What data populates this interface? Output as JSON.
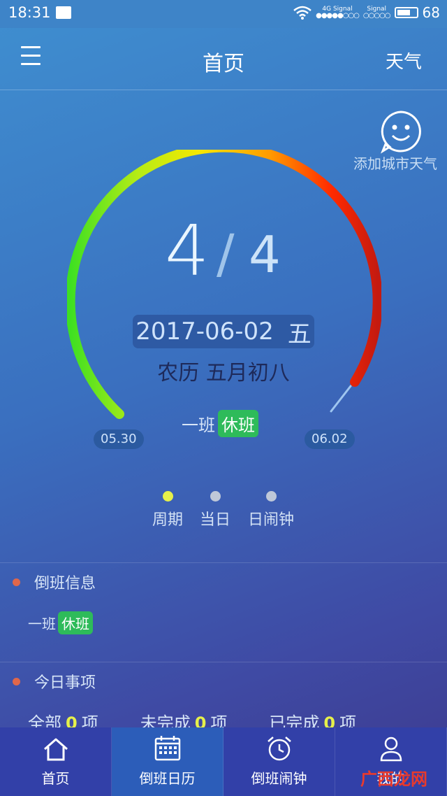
{
  "status_bar": {
    "time": "18:31",
    "network": "4G",
    "signal1": "Signal",
    "signal2": "Signal",
    "battery": "68"
  },
  "header": {
    "title": "首页",
    "weather": "天气"
  },
  "weather_widget": {
    "add_city": "添加城市天气"
  },
  "cycle": {
    "current": "4",
    "slash": "/",
    "total": "4",
    "date": "2017-06-02",
    "weekday": "五",
    "lunar": "农历 五月初八",
    "start_date": "05.30",
    "end_date": "06.02",
    "shift_name": "一班",
    "shift_status": "休班"
  },
  "pager": {
    "items": [
      "周期",
      "当日",
      "日闹钟"
    ],
    "active_index": 0,
    "active_color": "#e6f04a",
    "inactive_color": "#bfc8d8"
  },
  "shift_info": {
    "title": "倒班信息",
    "team": "一班",
    "status": "休班"
  },
  "today_tasks": {
    "title": "今日事项",
    "all_label": "全部",
    "all_count": "0",
    "unit": "项",
    "pending_label": "未完成",
    "pending_count": "0",
    "done_label": "已完成",
    "done_count": "0"
  },
  "bottom_nav": {
    "items": [
      {
        "label": "首页",
        "icon": "home-icon"
      },
      {
        "label": "倒班日历",
        "icon": "calendar-icon"
      },
      {
        "label": "倒班闹钟",
        "icon": "alarm-clock-icon"
      },
      {
        "label": "我的",
        "icon": "user-icon"
      }
    ],
    "active_index": 1
  },
  "watermark": "广西龙网"
}
